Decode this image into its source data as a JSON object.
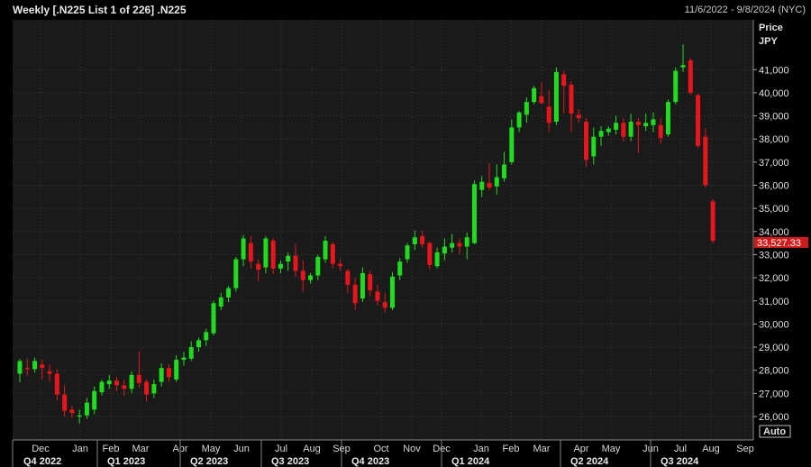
{
  "header": {
    "title": "Weekly [.N225 List 1 of 226] .N225",
    "date_range": "11/6/2022 - 9/8/2024 (NYC)"
  },
  "axis": {
    "price_label": "Price",
    "currency_label": "JPY",
    "auto_label": "Auto",
    "last_price_label": "33,527.33"
  },
  "colors": {
    "up": "#1fdc1f",
    "down": "#e8161c",
    "background": "#000000",
    "plot_background": "#1a1a1a",
    "grid": "#3a3a3a",
    "last_price_box": "#d11a1a"
  },
  "chart_data": {
    "type": "candlestick",
    "interval": "weekly",
    "ylim": [
      25400,
      42200
    ],
    "y_ticks": [
      26000,
      27000,
      28000,
      29000,
      30000,
      31000,
      32000,
      33000,
      34000,
      35000,
      36000,
      37000,
      38000,
      39000,
      40000,
      41000
    ],
    "y_tick_labels": [
      "26,000",
      "27,000",
      "28,000",
      "29,000",
      "30,000",
      "31,000",
      "32,000",
      "33,000",
      "34,000",
      "35,000",
      "36,000",
      "37,000",
      "38,000",
      "39,000",
      "40,000",
      "41,000"
    ],
    "month_labels": [
      "Dec",
      "Jan",
      "Feb",
      "Mar",
      "Apr",
      "May",
      "Jun",
      "Jul",
      "Aug",
      "Sep",
      "Oct",
      "Nov",
      "Dec",
      "Jan",
      "Feb",
      "Mar",
      "Apr",
      "May",
      "Jun",
      "Jul",
      "Aug",
      "Sep"
    ],
    "quarter_labels": [
      "Q4 2022",
      "Q1 2023",
      "Q2 2023",
      "Q3 2023",
      "Q4 2023",
      "Q1 2024",
      "Q2 2024",
      "Q3 2024"
    ],
    "last_price": 33527.33,
    "candles": [
      [
        27850,
        28400,
        28480,
        27480
      ],
      [
        28100,
        28050,
        28500,
        27750
      ],
      [
        28050,
        28400,
        28550,
        27900
      ],
      [
        28250,
        28100,
        28450,
        27600
      ],
      [
        27950,
        27850,
        28250,
        27500
      ],
      [
        27850,
        26950,
        28050,
        26700
      ],
      [
        26950,
        26250,
        27350,
        26000
      ],
      [
        26300,
        26150,
        26450,
        25950
      ],
      [
        26000,
        26050,
        26300,
        25700
      ],
      [
        26050,
        26600,
        26800,
        25900
      ],
      [
        26300,
        27100,
        27300,
        26100
      ],
      [
        27050,
        27500,
        27600,
        26900
      ],
      [
        27400,
        27550,
        27800,
        27200
      ],
      [
        27550,
        27350,
        27700,
        27100
      ],
      [
        27350,
        27200,
        27600,
        26900
      ],
      [
        27200,
        27800,
        27950,
        27000
      ],
      [
        27800,
        27450,
        28800,
        27250
      ],
      [
        27500,
        26950,
        27600,
        26650
      ],
      [
        27000,
        27400,
        27600,
        26800
      ],
      [
        27500,
        28100,
        28300,
        27300
      ],
      [
        28100,
        27700,
        28250,
        27500
      ],
      [
        27600,
        28450,
        28650,
        27500
      ],
      [
        28450,
        28550,
        28800,
        28200
      ],
      [
        28500,
        29000,
        29250,
        28400
      ],
      [
        29000,
        29300,
        29400,
        28800
      ],
      [
        29300,
        29650,
        29800,
        29050
      ],
      [
        29600,
        30900,
        31000,
        29500
      ],
      [
        30750,
        31150,
        31350,
        30600
      ],
      [
        31150,
        31550,
        31650,
        30950
      ],
      [
        31550,
        32800,
        32900,
        31400
      ],
      [
        32800,
        33700,
        33850,
        32500
      ],
      [
        33500,
        32700,
        33800,
        32400
      ],
      [
        32600,
        32350,
        32800,
        31850
      ],
      [
        32450,
        33700,
        33800,
        32200
      ],
      [
        33600,
        32400,
        33700,
        32150
      ],
      [
        32400,
        32600,
        32750,
        32200
      ],
      [
        32700,
        32950,
        33100,
        32300
      ],
      [
        32950,
        32300,
        33450,
        32050
      ],
      [
        32300,
        31900,
        32750,
        31400
      ],
      [
        31900,
        32100,
        32200,
        31750
      ],
      [
        32100,
        32900,
        33000,
        31900
      ],
      [
        32800,
        33600,
        33800,
        32650
      ],
      [
        33450,
        32600,
        33550,
        32400
      ],
      [
        32600,
        32500,
        32800,
        32300
      ],
      [
        32300,
        31700,
        32400,
        31350
      ],
      [
        31700,
        30900,
        32000,
        30600
      ],
      [
        31100,
        32200,
        32450,
        30950
      ],
      [
        32150,
        31450,
        32300,
        31200
      ],
      [
        31400,
        31000,
        31700,
        30800
      ],
      [
        30950,
        30700,
        31350,
        30500
      ],
      [
        30700,
        32050,
        32250,
        30600
      ],
      [
        32100,
        32700,
        32850,
        31900
      ],
      [
        32800,
        33400,
        33500,
        32650
      ],
      [
        33450,
        33750,
        34050,
        33200
      ],
      [
        33800,
        33450,
        34050,
        33300
      ],
      [
        33500,
        32550,
        33550,
        32350
      ],
      [
        32500,
        33100,
        33300,
        32400
      ],
      [
        33050,
        33350,
        33700,
        32750
      ],
      [
        33300,
        33500,
        33900,
        33100
      ],
      [
        33500,
        33350,
        33700,
        33000
      ],
      [
        33350,
        33750,
        33950,
        32800
      ],
      [
        33500,
        36050,
        36200,
        33450
      ],
      [
        35800,
        36150,
        36400,
        35500
      ],
      [
        36100,
        35900,
        36950,
        35800
      ],
      [
        35950,
        36350,
        36900,
        35600
      ],
      [
        36300,
        36900,
        37450,
        36150
      ],
      [
        37000,
        38500,
        38850,
        36900
      ],
      [
        38500,
        39150,
        39200,
        38300
      ],
      [
        39050,
        39600,
        39800,
        38700
      ],
      [
        39600,
        40200,
        40300,
        39500
      ],
      [
        39850,
        39550,
        40450,
        39500
      ],
      [
        39400,
        38700,
        40100,
        38300
      ],
      [
        38750,
        40900,
        41100,
        38600
      ],
      [
        40800,
        40300,
        40950,
        39100
      ],
      [
        40350,
        39100,
        40500,
        38300
      ],
      [
        39050,
        38900,
        39300,
        38700
      ],
      [
        38750,
        37100,
        38900,
        36800
      ],
      [
        37250,
        38100,
        38500,
        36900
      ],
      [
        38100,
        38350,
        38550,
        37700
      ],
      [
        38300,
        38450,
        38550,
        38150
      ],
      [
        38400,
        38700,
        39000,
        38200
      ],
      [
        38700,
        38100,
        38900,
        37900
      ],
      [
        38100,
        38750,
        39100,
        37900
      ],
      [
        38750,
        38600,
        38900,
        37400
      ],
      [
        38550,
        38700,
        39100,
        38350
      ],
      [
        38600,
        38850,
        39150,
        38300
      ],
      [
        38600,
        38050,
        38900,
        37800
      ],
      [
        38200,
        39600,
        39700,
        38100
      ],
      [
        39600,
        40950,
        41100,
        39500
      ],
      [
        41100,
        41200,
        42100,
        40900
      ],
      [
        41400,
        40000,
        41500,
        39900
      ],
      [
        39900,
        37700,
        39950,
        37600
      ],
      [
        38100,
        36000,
        38450,
        35900
      ],
      [
        35300,
        33600,
        35400,
        33500
      ]
    ]
  }
}
